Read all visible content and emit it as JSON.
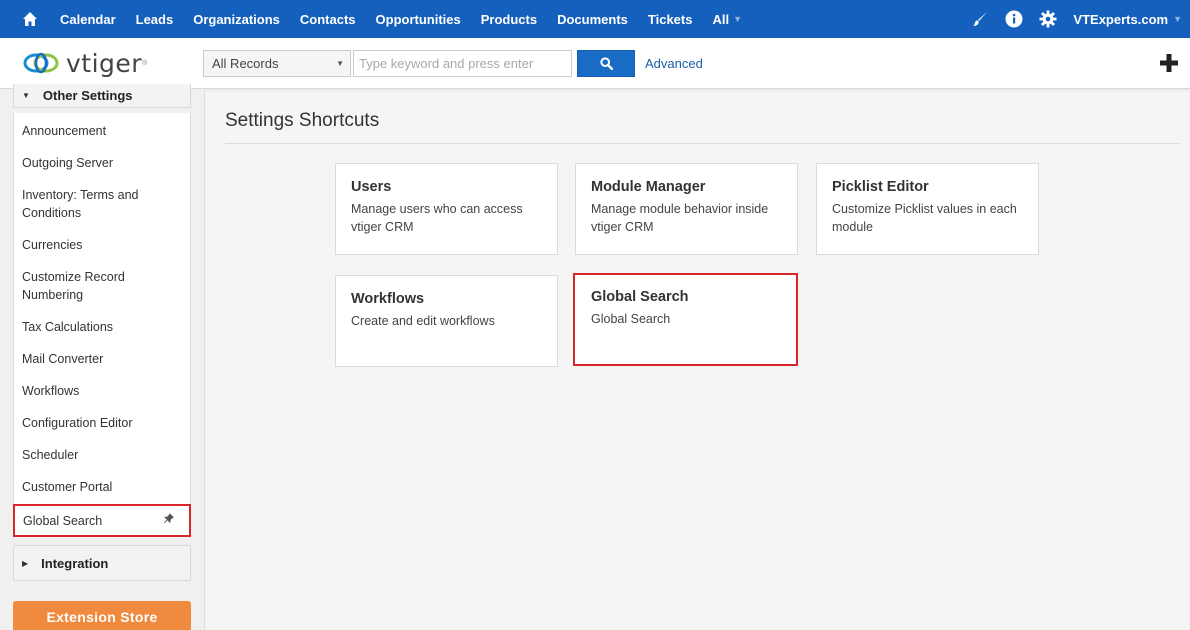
{
  "topnav": {
    "items": [
      "Calendar",
      "Leads",
      "Organizations",
      "Contacts",
      "Opportunities",
      "Products",
      "Documents",
      "Tickets"
    ],
    "all_label": "All",
    "user": "VTExperts.com",
    "bg_color": "#1560bd"
  },
  "logo": {
    "text": "vtiger",
    "mark": "®"
  },
  "search": {
    "scope": "All Records",
    "placeholder": "Type keyword and press enter",
    "advanced": "Advanced"
  },
  "sidebar": {
    "other_settings": "Other Settings",
    "items": [
      "Announcement",
      "Outgoing Server",
      "Inventory: Terms and Conditions",
      "Currencies",
      "Customize Record Numbering",
      "Tax Calculations",
      "Mail Converter",
      "Workflows",
      "Configuration Editor",
      "Scheduler",
      "Customer Portal",
      "Global Search"
    ],
    "integration": "Integration",
    "extension_store": "Extension Store"
  },
  "main": {
    "title": "Settings Shortcuts",
    "cards": [
      {
        "title": "Users",
        "desc": "Manage users who can access vtiger CRM"
      },
      {
        "title": "Module Manager",
        "desc": "Manage module behavior inside vtiger CRM"
      },
      {
        "title": "Picklist Editor",
        "desc": "Customize Picklist values in each module"
      },
      {
        "title": "Workflows",
        "desc": "Create and edit workflows"
      },
      {
        "title": "Global Search",
        "desc": "Global Search"
      }
    ]
  },
  "colors": {
    "highlight": "#d9262d",
    "accent": "#1a6bc6",
    "store": "#f08a3e"
  }
}
